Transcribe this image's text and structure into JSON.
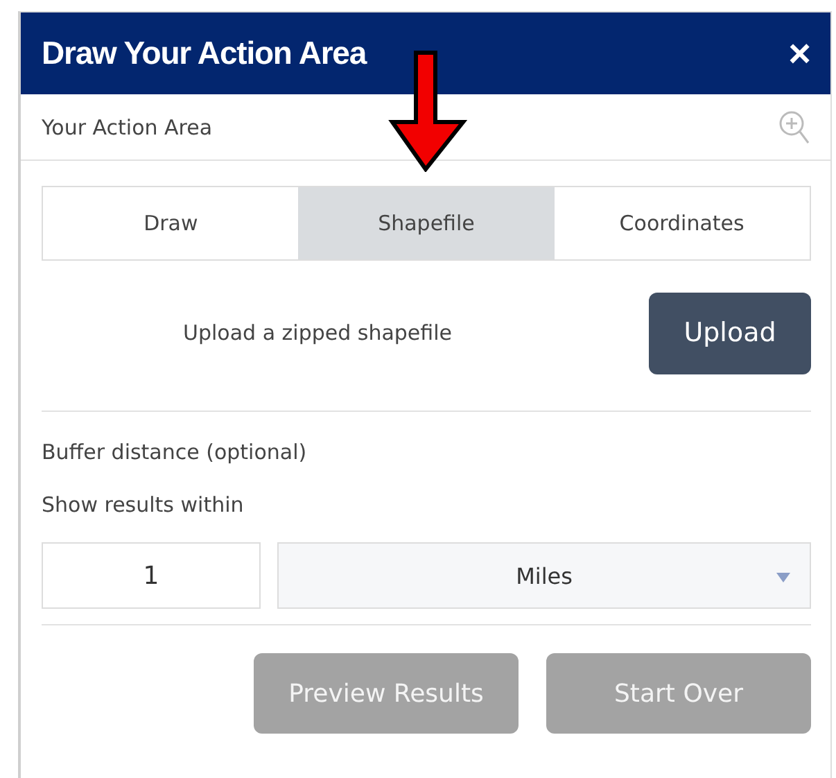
{
  "window": {
    "title": "Draw Your Action Area",
    "close": "×"
  },
  "subheader": {
    "label": "Your Action Area"
  },
  "tabs": [
    {
      "label": "Draw",
      "selected": false
    },
    {
      "label": "Shapefile",
      "selected": true
    },
    {
      "label": "Coordinates",
      "selected": false
    }
  ],
  "upload": {
    "label": "Upload a zipped shapefile",
    "button": "Upload"
  },
  "buffer": {
    "title": "Buffer distance (optional)",
    "label": "Show results within",
    "distance": "1",
    "unit": "Miles"
  },
  "buttons": [
    {
      "label": "Preview Results",
      "disabled": true
    },
    {
      "label": "Start Over",
      "disabled": true
    }
  ],
  "annotation": {
    "kind": "arrow"
  }
}
